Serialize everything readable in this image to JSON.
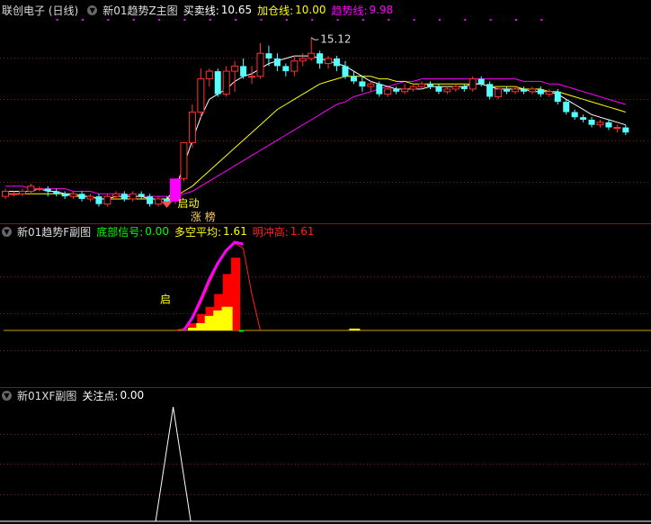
{
  "main_header": {
    "stock": "联创电子 (日线)",
    "indicator": "新01趋势Z主图",
    "buy_sell": {
      "label": "买卖线:",
      "value": "10.65"
    },
    "add_pos": {
      "label": "加仓线:",
      "value": "10.00"
    },
    "trend": {
      "label": "趋势线:",
      "value": "9.98"
    }
  },
  "main_annotations": {
    "high_price": "15.12",
    "start": "启动",
    "limit_up": "涨 榜"
  },
  "sub1_header": {
    "indicator": "新01趋势F副图",
    "bottom": {
      "label": "底部信号:",
      "value": "0.00"
    },
    "avg": {
      "label": "多空平均:",
      "value": "1.61"
    },
    "surge": {
      "label": "明冲高:",
      "value": "1.61"
    },
    "start_label": "启"
  },
  "sub2_header": {
    "indicator": "新01XF副图",
    "focus": {
      "label": "关注点:",
      "value": "0.00"
    }
  },
  "colors": {
    "up": "#ff3232",
    "down": "#54ffff",
    "yellow": "#ffff00",
    "magenta": "#ff00ff",
    "white": "#ffffff",
    "green": "#00ff00",
    "red": "#ff2020",
    "divider": "#7a1a1a"
  },
  "chart_data": {
    "type": "candlestick",
    "candles": [
      [
        8.9,
        9.1,
        9.2,
        8.8
      ],
      [
        9.0,
        9.0,
        9.1,
        8.9
      ],
      [
        9.0,
        9.1,
        9.2,
        8.9
      ],
      [
        9.1,
        9.3,
        9.4,
        9.0
      ],
      [
        9.2,
        9.2,
        9.3,
        9.1
      ],
      [
        9.2,
        9.1,
        9.3,
        8.9
      ],
      [
        9.1,
        9.0,
        9.2,
        8.9
      ],
      [
        9.0,
        8.9,
        9.1,
        8.8
      ],
      [
        8.9,
        9.0,
        9.1,
        8.8
      ],
      [
        9.0,
        8.8,
        9.1,
        8.7
      ],
      [
        8.8,
        8.9,
        9.0,
        8.7
      ],
      [
        8.9,
        8.6,
        9.0,
        8.5
      ],
      [
        8.6,
        8.9,
        9.0,
        8.5
      ],
      [
        8.9,
        9.0,
        9.1,
        8.8
      ],
      [
        9.0,
        8.8,
        9.1,
        8.7
      ],
      [
        8.8,
        9.0,
        9.1,
        8.7
      ],
      [
        9.0,
        8.9,
        9.1,
        8.8
      ],
      [
        8.9,
        8.6,
        9.0,
        8.5
      ],
      [
        8.6,
        8.8,
        8.9,
        8.5
      ],
      [
        8.8,
        8.7,
        8.9,
        8.6
      ],
      [
        8.7,
        9.6,
        9.6,
        8.6
      ],
      [
        9.6,
        11.0,
        11.0,
        9.5
      ],
      [
        11.0,
        12.2,
        12.5,
        10.8
      ],
      [
        12.2,
        13.5,
        13.9,
        12.0
      ],
      [
        13.5,
        13.8,
        13.9,
        13.2
      ],
      [
        13.8,
        12.9,
        13.9,
        12.8
      ],
      [
        12.9,
        13.8,
        14.0,
        12.8
      ],
      [
        13.8,
        14.0,
        14.2,
        13.0
      ],
      [
        14.0,
        13.6,
        14.3,
        13.5
      ],
      [
        13.6,
        13.6,
        14.0,
        13.3
      ],
      [
        13.6,
        14.5,
        14.9,
        13.5
      ],
      [
        14.5,
        14.3,
        14.8,
        14.0
      ],
      [
        14.3,
        14.0,
        14.5,
        13.8
      ],
      [
        14.0,
        13.8,
        14.1,
        13.6
      ],
      [
        13.8,
        14.2,
        14.4,
        13.6
      ],
      [
        14.2,
        14.3,
        14.5,
        14.0
      ],
      [
        14.3,
        14.5,
        15.12,
        14.2
      ],
      [
        14.5,
        14.1,
        14.6,
        13.9
      ],
      [
        14.1,
        14.3,
        14.4,
        13.9
      ],
      [
        14.3,
        14.0,
        14.4,
        13.8
      ],
      [
        14.0,
        13.6,
        14.2,
        13.5
      ],
      [
        13.6,
        13.4,
        13.8,
        13.3
      ],
      [
        13.4,
        13.2,
        13.6,
        13.0
      ],
      [
        13.2,
        13.3,
        13.4,
        13.0
      ],
      [
        13.3,
        12.9,
        13.4,
        12.8
      ],
      [
        12.9,
        13.1,
        13.2,
        12.8
      ],
      [
        13.1,
        13.0,
        13.2,
        12.9
      ],
      [
        13.0,
        13.1,
        13.3,
        12.9
      ],
      [
        13.1,
        13.2,
        13.3,
        13.0
      ],
      [
        13.2,
        13.3,
        13.4,
        13.1
      ],
      [
        13.3,
        13.2,
        13.4,
        13.1
      ],
      [
        13.2,
        13.0,
        13.3,
        12.9
      ],
      [
        13.0,
        13.1,
        13.2,
        12.9
      ],
      [
        13.1,
        13.2,
        13.3,
        13.0
      ],
      [
        13.2,
        13.1,
        13.3,
        13.0
      ],
      [
        13.1,
        13.5,
        13.6,
        13.0
      ],
      [
        13.5,
        13.3,
        13.6,
        13.2
      ],
      [
        13.3,
        12.8,
        13.4,
        12.7
      ],
      [
        12.8,
        13.1,
        13.2,
        12.7
      ],
      [
        13.1,
        13.0,
        13.2,
        12.9
      ],
      [
        13.0,
        13.1,
        13.2,
        12.9
      ],
      [
        13.1,
        13.0,
        13.2,
        12.9
      ],
      [
        13.0,
        13.1,
        13.2,
        12.9
      ],
      [
        13.1,
        12.9,
        13.2,
        12.8
      ],
      [
        12.9,
        13.0,
        13.1,
        12.8
      ],
      [
        13.0,
        12.6,
        13.1,
        12.5
      ],
      [
        12.6,
        12.2,
        12.7,
        12.1
      ],
      [
        12.2,
        12.0,
        12.3,
        11.9
      ],
      [
        12.0,
        11.9,
        12.1,
        11.8
      ],
      [
        11.9,
        11.7,
        12.0,
        11.6
      ],
      [
        11.7,
        11.8,
        11.9,
        11.6
      ],
      [
        11.8,
        11.6,
        11.9,
        11.5
      ],
      [
        11.6,
        11.6,
        11.7,
        11.4
      ],
      [
        11.6,
        11.4,
        11.7,
        11.3
      ]
    ],
    "ylim": [
      8.2,
      15.6
    ],
    "buy_sell_line": [
      9.1,
      9.1,
      9.1,
      9.1,
      9.2,
      9.1,
      9.1,
      9.0,
      9.0,
      8.9,
      8.9,
      8.8,
      8.8,
      8.9,
      8.9,
      8.9,
      8.9,
      8.8,
      8.8,
      8.8,
      9.2,
      10.1,
      11.1,
      12.0,
      12.7,
      12.9,
      13.1,
      13.4,
      13.6,
      13.7,
      13.9,
      14.1,
      14.2,
      14.3,
      14.4,
      14.4,
      14.4,
      14.3,
      14.2,
      14.1,
      14.0,
      13.8,
      13.6,
      13.4,
      13.3,
      13.2,
      13.1,
      13.1,
      13.1,
      13.1,
      13.2,
      13.2,
      13.2,
      13.2,
      13.2,
      13.3,
      13.3,
      13.2,
      13.1,
      13.1,
      13.1,
      13.1,
      13.0,
      13.0,
      13.0,
      12.9,
      12.7,
      12.5,
      12.3,
      12.1,
      12.0,
      11.9,
      11.8,
      11.7
    ],
    "add_pos_line": [
      9.0,
      9.0,
      9.0,
      9.0,
      9.0,
      9.0,
      9.0,
      9.0,
      8.9,
      8.9,
      8.9,
      8.8,
      8.8,
      8.8,
      8.8,
      8.8,
      8.8,
      8.8,
      8.8,
      8.8,
      8.9,
      9.1,
      9.3,
      9.6,
      9.9,
      10.2,
      10.5,
      10.8,
      11.1,
      11.4,
      11.7,
      12.0,
      12.3,
      12.5,
      12.7,
      12.9,
      13.1,
      13.3,
      13.4,
      13.5,
      13.6,
      13.6,
      13.6,
      13.6,
      13.5,
      13.5,
      13.4,
      13.4,
      13.3,
      13.3,
      13.3,
      13.3,
      13.3,
      13.3,
      13.3,
      13.3,
      13.3,
      13.2,
      13.2,
      13.2,
      13.2,
      13.1,
      13.1,
      13.1,
      13.0,
      13.0,
      12.9,
      12.8,
      12.7,
      12.6,
      12.5,
      12.4,
      12.3,
      12.2
    ],
    "trend_line": [
      9.3,
      9.3,
      9.3,
      9.2,
      9.2,
      9.2,
      9.2,
      9.2,
      9.1,
      9.1,
      9.1,
      9.0,
      9.0,
      9.0,
      9.0,
      8.9,
      8.9,
      8.9,
      8.9,
      8.9,
      8.9,
      9.0,
      9.1,
      9.3,
      9.5,
      9.7,
      9.9,
      10.1,
      10.3,
      10.5,
      10.7,
      10.9,
      11.1,
      11.3,
      11.5,
      11.7,
      11.9,
      12.1,
      12.3,
      12.5,
      12.6,
      12.8,
      12.9,
      13.0,
      13.1,
      13.2,
      13.3,
      13.4,
      13.4,
      13.5,
      13.5,
      13.5,
      13.5,
      13.5,
      13.5,
      13.5,
      13.5,
      13.5,
      13.5,
      13.5,
      13.5,
      13.4,
      13.4,
      13.4,
      13.3,
      13.3,
      13.2,
      13.1,
      13.0,
      12.9,
      12.8,
      12.7,
      12.6,
      12.5
    ],
    "sub1": {
      "ylim": [
        0,
        100
      ],
      "red_bars": [
        {
          "i": 21,
          "v": 8
        },
        {
          "i": 22,
          "v": 18
        },
        {
          "i": 23,
          "v": 26
        },
        {
          "i": 24,
          "v": 40
        },
        {
          "i": 25,
          "v": 62
        },
        {
          "i": 26,
          "v": 80
        }
      ],
      "yellow_bars": [
        {
          "i": 21,
          "v": 3
        },
        {
          "i": 22,
          "v": 8
        },
        {
          "i": 23,
          "v": 16
        },
        {
          "i": 24,
          "v": 22
        },
        {
          "i": 25,
          "v": 26
        },
        {
          "i": 26,
          "v": 0
        },
        {
          "i": 40,
          "v": 2
        }
      ],
      "magenta_curve": [
        {
          "i": 20,
          "v": 0
        },
        {
          "i": 21,
          "v": 14
        },
        {
          "i": 22,
          "v": 34
        },
        {
          "i": 23,
          "v": 56
        },
        {
          "i": 24,
          "v": 74
        },
        {
          "i": 25,
          "v": 88
        },
        {
          "i": 26,
          "v": 97
        },
        {
          "i": 27,
          "v": 95
        }
      ],
      "red_curve": [
        {
          "i": 19,
          "v": 0
        },
        {
          "i": 20,
          "v": 2
        },
        {
          "i": 21,
          "v": 12
        },
        {
          "i": 22,
          "v": 30
        },
        {
          "i": 23,
          "v": 52
        },
        {
          "i": 24,
          "v": 72
        },
        {
          "i": 25,
          "v": 88
        },
        {
          "i": 26,
          "v": 96
        },
        {
          "i": 27,
          "v": 90
        },
        {
          "i": 28,
          "v": 40
        },
        {
          "i": 29,
          "v": 0
        }
      ]
    },
    "sub2": {
      "ylim": [
        0,
        1
      ],
      "spike": [
        {
          "i": 18,
          "v": 0
        },
        {
          "i": 20,
          "v": 1
        },
        {
          "i": 22,
          "v": 0
        }
      ]
    }
  }
}
